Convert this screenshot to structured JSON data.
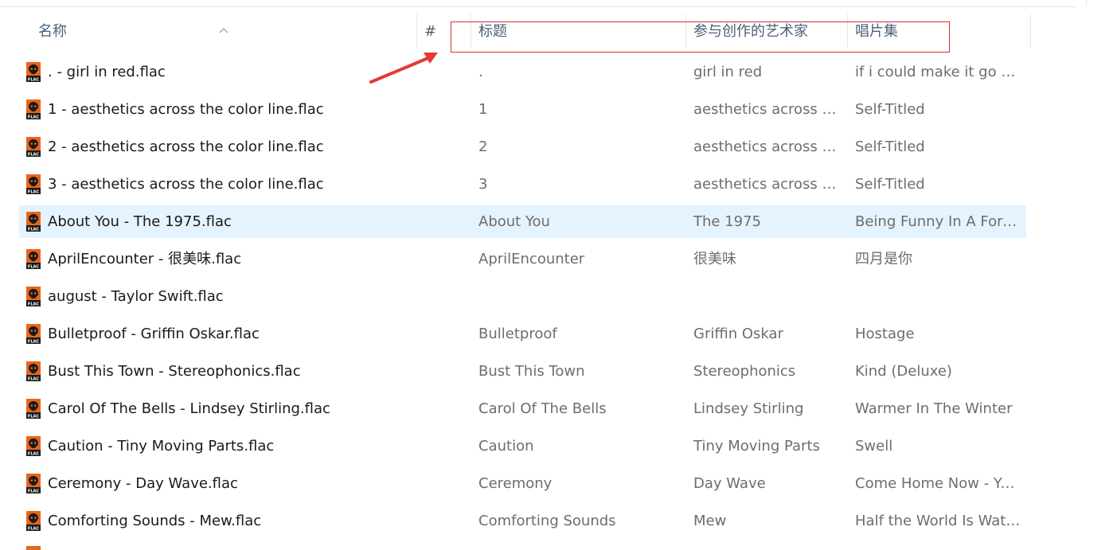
{
  "header": {
    "name": "名称",
    "number": "#",
    "title": "标题",
    "artist": "参与创作的艺术家",
    "album": "唱片集"
  },
  "icons": {
    "sort": "sort-ascending-icon",
    "file": "flac-file-icon",
    "annotation": "red-arrow-icon"
  },
  "colors": {
    "highlight_border": "#d32f2f",
    "selected_row": "#e5f3ff",
    "flac_orange": "#e8661a"
  },
  "rows": [
    {
      "name": ". - girl in red.flac",
      "title": ".",
      "artist": "girl in red",
      "album": "if i could make it go q..."
    },
    {
      "name": "1 - aesthetics across the color line.flac",
      "title": "1",
      "artist": "aesthetics across th...",
      "album": "Self-Titled"
    },
    {
      "name": "2 - aesthetics across the color line.flac",
      "title": "2",
      "artist": "aesthetics across th...",
      "album": "Self-Titled"
    },
    {
      "name": "3 - aesthetics across the color line.flac",
      "title": "3",
      "artist": "aesthetics across th...",
      "album": "Self-Titled"
    },
    {
      "name": "About You - The 1975.flac",
      "title": "About You",
      "artist": "The 1975",
      "album": "Being Funny In A Forei...",
      "selected": true
    },
    {
      "name": "AprilEncounter - 很美味.flac",
      "title": "AprilEncounter",
      "artist": "很美味",
      "album": "四月是你"
    },
    {
      "name": "august - Taylor Swift.flac",
      "title": "",
      "artist": "",
      "album": ""
    },
    {
      "name": "Bulletproof - Griffin Oskar.flac",
      "title": "Bulletproof",
      "artist": "Griffin Oskar",
      "album": "Hostage"
    },
    {
      "name": "Bust This Town - Stereophonics.flac",
      "title": "Bust This Town",
      "artist": "Stereophonics",
      "album": "Kind (Deluxe)"
    },
    {
      "name": "Carol Of The Bells - Lindsey Stirling.flac",
      "title": "Carol Of The Bells",
      "artist": "Lindsey Stirling",
      "album": "Warmer In The Winter"
    },
    {
      "name": "Caution - Tiny Moving Parts.flac",
      "title": "Caution",
      "artist": "Tiny Moving Parts",
      "album": "Swell"
    },
    {
      "name": "Ceremony - Day Wave.flac",
      "title": "Ceremony",
      "artist": "Day Wave",
      "album": "Come Home Now - Yo..."
    },
    {
      "name": "Comforting Sounds - Mew.flac",
      "title": "Comforting Sounds",
      "artist": "Mew",
      "album": "Half the World Is Watc..."
    }
  ]
}
